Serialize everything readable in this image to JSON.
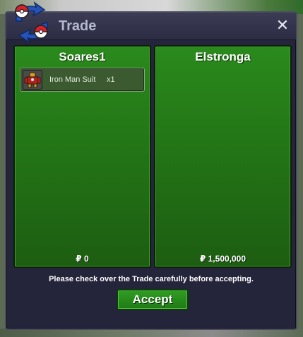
{
  "window": {
    "title": "Trade",
    "close_symbol": "✕",
    "logo_icon": "pokeball-swap-icon"
  },
  "players": [
    {
      "name": "Soares1",
      "items": [
        {
          "name": "Iron Man Suit",
          "quantity": "x1",
          "icon": "iron-man-suit-icon"
        }
      ],
      "money": "₽ 0"
    },
    {
      "name": "Elstronga",
      "items": [],
      "money": "₽ 1,500,000"
    }
  ],
  "notice": "Please check over the Trade carefully before accepting.",
  "accept_label": "Accept",
  "colors": {
    "panel_green": "#237516",
    "window_bg": "#24243a",
    "title_text": "#b4b8d0"
  }
}
